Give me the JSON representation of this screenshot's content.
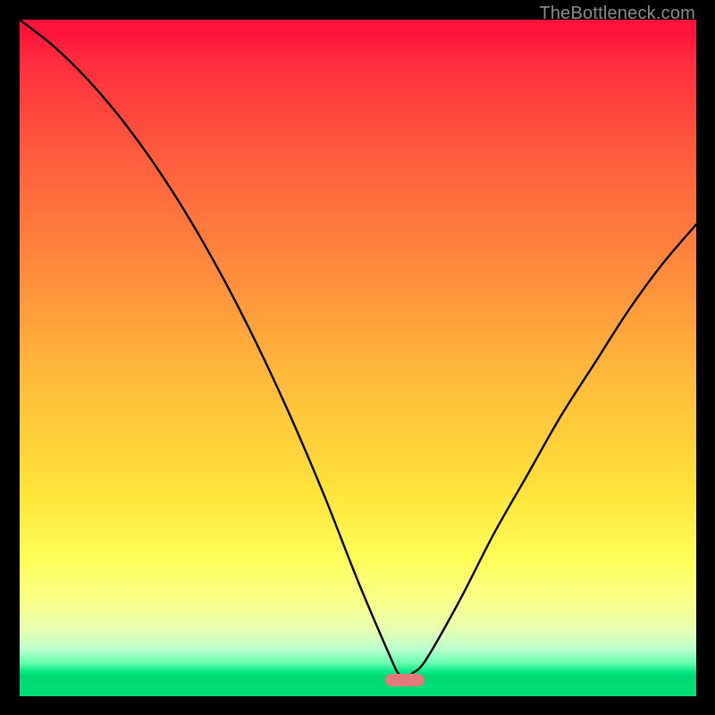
{
  "watermark": "TheBottleneck.com",
  "chart_data": {
    "type": "line",
    "title": "",
    "xlabel": "",
    "ylabel": "",
    "xlim": [
      0,
      100
    ],
    "ylim": [
      0,
      100
    ],
    "x": [
      0,
      5,
      10,
      15,
      20,
      25,
      30,
      35,
      40,
      45,
      50,
      55,
      56,
      57,
      58,
      60,
      65,
      70,
      75,
      80,
      85,
      90,
      95,
      100
    ],
    "values": [
      100,
      96,
      91,
      85,
      78,
      70,
      61,
      51,
      40,
      28,
      15,
      3,
      1,
      0,
      1,
      3,
      12,
      22,
      31,
      40,
      48,
      56,
      63,
      69
    ],
    "minimum_x": 57,
    "minimum_y": 0,
    "pill": {
      "x_pct": 57,
      "y_pct_from_top": 97.6,
      "color": "#e47a7a"
    },
    "gradient_stops": [
      {
        "pct": 0,
        "color": "#ff143c"
      },
      {
        "pct": 20,
        "color": "#ff5c3e"
      },
      {
        "pct": 50,
        "color": "#ffb83a"
      },
      {
        "pct": 80,
        "color": "#feff5a"
      },
      {
        "pct": 97,
        "color": "#00d874"
      },
      {
        "pct": 100,
        "color": "#00e078"
      }
    ]
  }
}
